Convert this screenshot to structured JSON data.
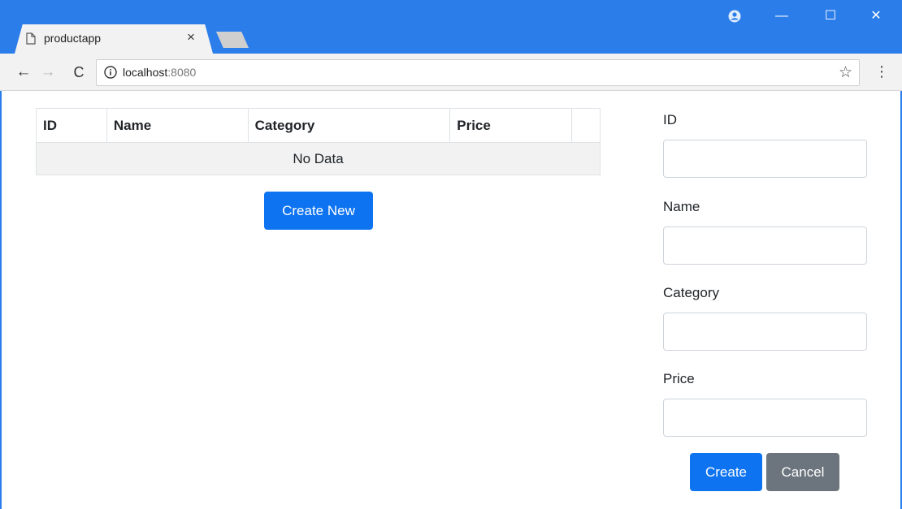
{
  "browser": {
    "tab_title": "productapp",
    "tab_close": "×",
    "url_host": "localhost",
    "url_port": ":8080",
    "accent": "#2b7de9"
  },
  "table": {
    "headers": [
      "ID",
      "Name",
      "Category",
      "Price",
      ""
    ],
    "empty_message": "No Data"
  },
  "buttons": {
    "create_new": "Create New",
    "create": "Create",
    "cancel": "Cancel"
  },
  "form": {
    "id_label": "ID",
    "name_label": "Name",
    "category_label": "Category",
    "price_label": "Price",
    "id_value": "",
    "name_value": "",
    "category_value": "",
    "price_value": ""
  },
  "icons": {
    "back": "←",
    "forward": "→",
    "reload": "C",
    "star": "☆",
    "menu": "⋮",
    "minimize": "—",
    "maximize": "☐",
    "close": "✕"
  },
  "colors": {
    "primary": "#0d73f0",
    "secondary": "#6c757d",
    "titlebar": "#2b7de9"
  }
}
